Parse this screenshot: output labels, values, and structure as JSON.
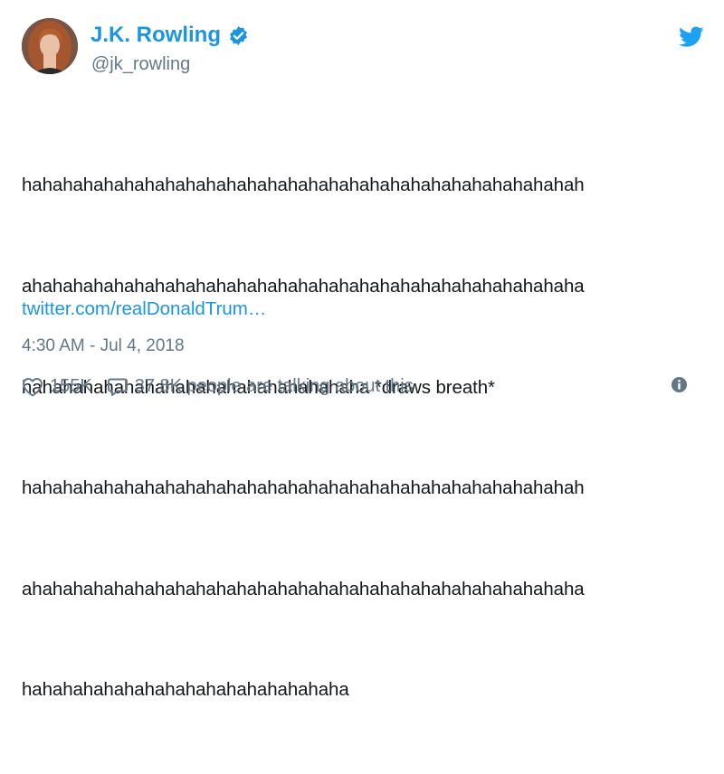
{
  "author": {
    "display_name": "J.K. Rowling",
    "handle": "@jk_rowling",
    "verified": true
  },
  "tweet": {
    "lines": [
      "hahahahahahahahahahahahahahahahahahahahahahahahahahahah",
      "ahahahahahahahahahahahahahahahahahahahahahahahahahahaha",
      "hahahahahahahahahahahahahahahahaha *draws breath*",
      "hahahahahahahahahahahahahahahahahahahahahahahahahahahah",
      "ahahahahahahahahahahahahahahahahahahahahahahahahahahaha",
      "hahahahahahahahahahahahahahahaha"
    ],
    "link_text": "twitter.com/realDonaldTrum…",
    "timestamp": "4:30 AM - Jul 4, 2018"
  },
  "actions": {
    "likes": "155K",
    "conversation": "37.8K people are talking about this"
  },
  "icons": {
    "brand": "twitter-bird-icon",
    "verified": "verified-badge-icon",
    "like": "heart-icon",
    "reply": "speech-bubble-icon",
    "info": "info-icon"
  },
  "colors": {
    "accent": "#1b95e0",
    "muted": "#657786",
    "text": "#14171a"
  }
}
